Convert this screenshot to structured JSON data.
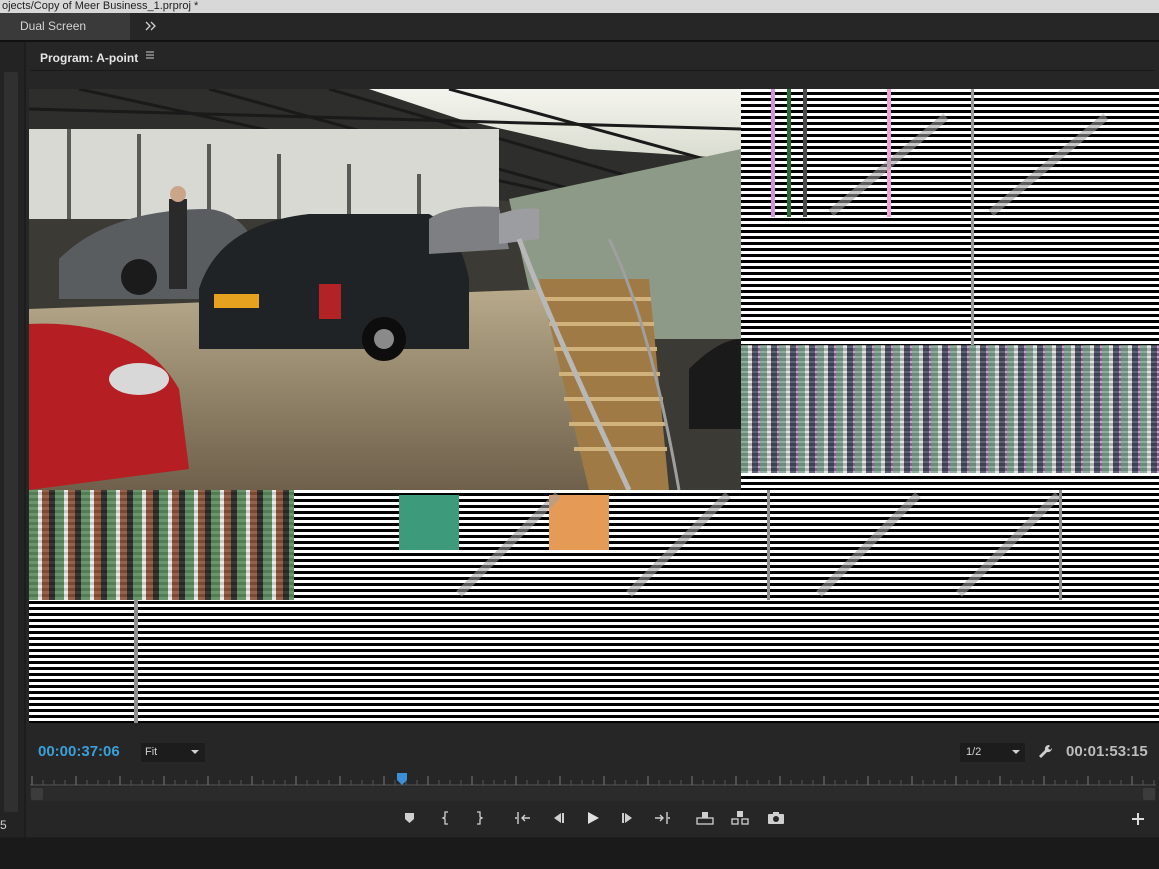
{
  "window": {
    "title": "ojects/Copy of Meer Business_1.prproj *"
  },
  "workspace": {
    "active_tab": "Dual Screen",
    "more_icon": "chevron-double-right"
  },
  "left_panel": {
    "number": "5"
  },
  "monitor": {
    "title": "Program: A-point",
    "menu_icon": "hamburger-menu",
    "timecode_current": "00:00:37:06",
    "zoom": "Fit",
    "resolution": "1/2",
    "timecode_duration": "00:01:53:15",
    "playhead_fraction": 0.33,
    "colors": {
      "timecode_blue": "#3b9fd9",
      "playhead_blue": "#3b8fd6",
      "panel_bg": "#262626"
    }
  },
  "transport": {
    "buttons": [
      "add-marker",
      "mark-in",
      "mark-out",
      "go-to-in",
      "step-back",
      "play",
      "step-forward",
      "go-to-out",
      "lift",
      "extract",
      "export-frame"
    ],
    "add_button_icon": "plus"
  }
}
